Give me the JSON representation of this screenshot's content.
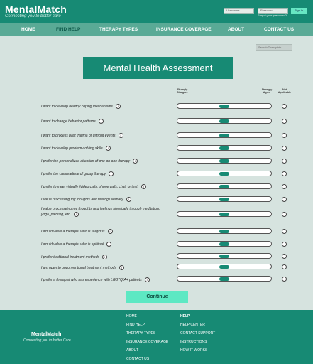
{
  "header": {
    "logo_title": "MentalMatch",
    "logo_tagline": "Connecting you to better care",
    "username_placeholder": "Username",
    "password_placeholder": "Password",
    "forgot_password": "Forgot your password?",
    "sign_in": "Sign in"
  },
  "nav": {
    "items": [
      "HOME",
      "FIND HELP",
      "THERAPY TYPES",
      "INSURANCE COVERAGE",
      "ABOUT",
      "CONTACT US"
    ],
    "active": "FIND HELP"
  },
  "search": {
    "placeholder": "Search Therapists"
  },
  "assessment": {
    "title": "Mental Health Assessment",
    "scale_left": "Strongly Disagree",
    "scale_right": "Strongly Agree",
    "not_applicable": "Not Applicable",
    "questions": [
      "I want to develop healthy coping mechanisms",
      "I want to change behavior patterns",
      "I want to process past trauma or difficult events",
      "I want to develop problem-solving skills",
      "I prefer the personalized attention of one-on-one therapy",
      "I prefer the camaraderie of group therapy",
      "I prefer to meet virtually (video calls, phone calls, chat, or text)",
      "I value processing my thoughts and feelings verbally",
      "I value processeing my thoughts and feelings physically through meditation, yoga, painting, etc.",
      "I would value a therapist who is religious",
      "I would value a therapist who is spiritual",
      "I prefer traditional treatment methods",
      "I am open to unconventional treatment methods",
      "I prefer a therapist who has experience with LGBTQIA+ patients"
    ],
    "slider_value": 0.5,
    "continue": "Continue"
  },
  "footer": {
    "name": "MentalMatch",
    "tagline": "Connecting you to better Care",
    "col1": [
      "HOME",
      "FIND HELP",
      "THERAPY TYPES",
      "INSURANCE COVERAGE",
      "ABOUT",
      "CONTACT US"
    ],
    "col2_title": "HELP",
    "col2": [
      "HELP CENTER",
      "CONTACT SUPPORT",
      "INSTRUCTIONS",
      "HOW IT WORKS"
    ]
  },
  "icons": {
    "info": "info-icon"
  },
  "colors": {
    "brand": "#178a74",
    "nav": "#5aaa96",
    "accent": "#5de8c3",
    "background": "#d6e3df"
  }
}
